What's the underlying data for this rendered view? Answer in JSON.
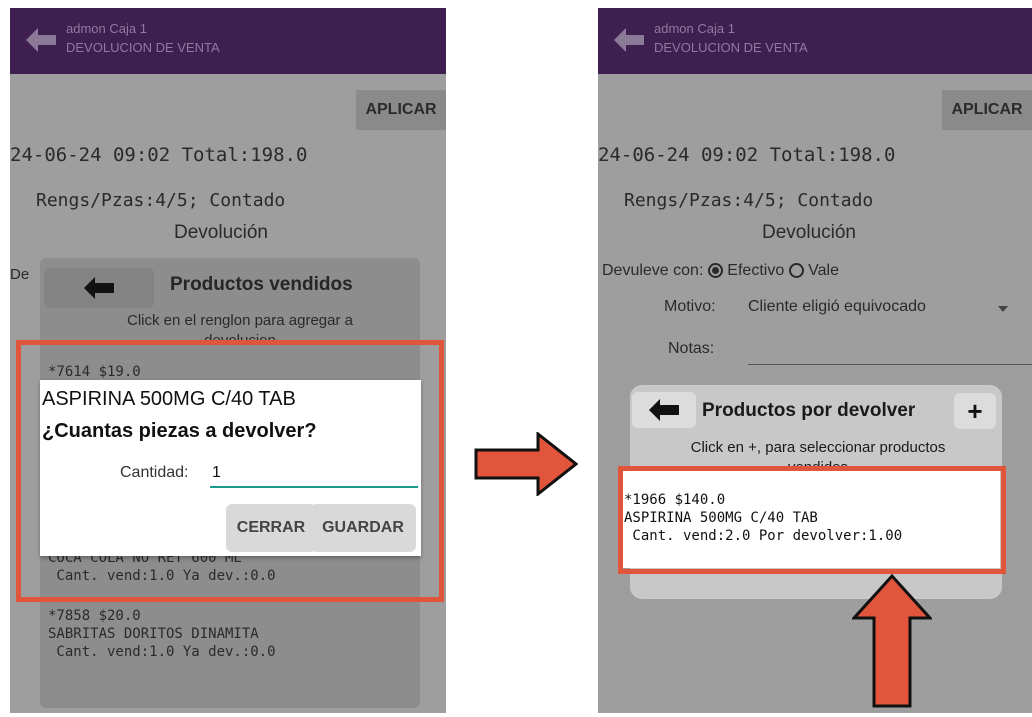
{
  "app": {
    "user": "admon Caja 1",
    "screen_title": "DEVOLUCION DE VENTA",
    "apply_label": "APLICAR"
  },
  "sale": {
    "datetime_total": "24-06-24 09:02 Total:198.0",
    "summary": "Rengs/Pzas:4/5; Contado",
    "devolucion_header": "Devolución",
    "devuelve_con_short": "De",
    "devuelve_con_label": "Devuleve con:",
    "option_cash": "Efectivo",
    "option_voucher": "Vale",
    "motivo_label": "Motivo:",
    "motivo_value": "Cliente eligió equivocado",
    "notas_label": "Notas:"
  },
  "left_panel": {
    "title": "Productos vendidos",
    "hint_line1": "Click en el renglon para agregar a",
    "hint_line2": "devolucion",
    "row1_header": "*7614 $19.0",
    "row2_product_partial": "COCA COLA NO RET 600 ML",
    "row2_qty": " Cant. vend:1.0 Ya dev.:0.0",
    "row3_header": "*7858 $20.0",
    "row3_product": "SABRITAS DORITOS DINAMITA",
    "row3_qty": " Cant. vend:1.0 Ya dev.:0.0"
  },
  "dialog": {
    "product": "ASPIRINA 500MG C/40 TAB",
    "question": "¿Cuantas piezas a devolver?",
    "qty_label": "Cantidad:",
    "qty_value": "1",
    "close_label": "CERRAR",
    "save_label": "GUARDAR"
  },
  "right_panel": {
    "title": "Productos por devolver",
    "plus": "+",
    "hint_line1": "Click en +, para seleccionar productos",
    "hint_line2": "vendidos",
    "item_header": "*1966 $140.0",
    "item_product": "ASPIRINA 500MG C/40 TAB",
    "item_qty": " Cant. vend:2.0 Por devolver:1.00"
  },
  "colors": {
    "appbar": "#3e1f50",
    "highlight": "#e0553c",
    "input_line": "#1a9a8c"
  }
}
